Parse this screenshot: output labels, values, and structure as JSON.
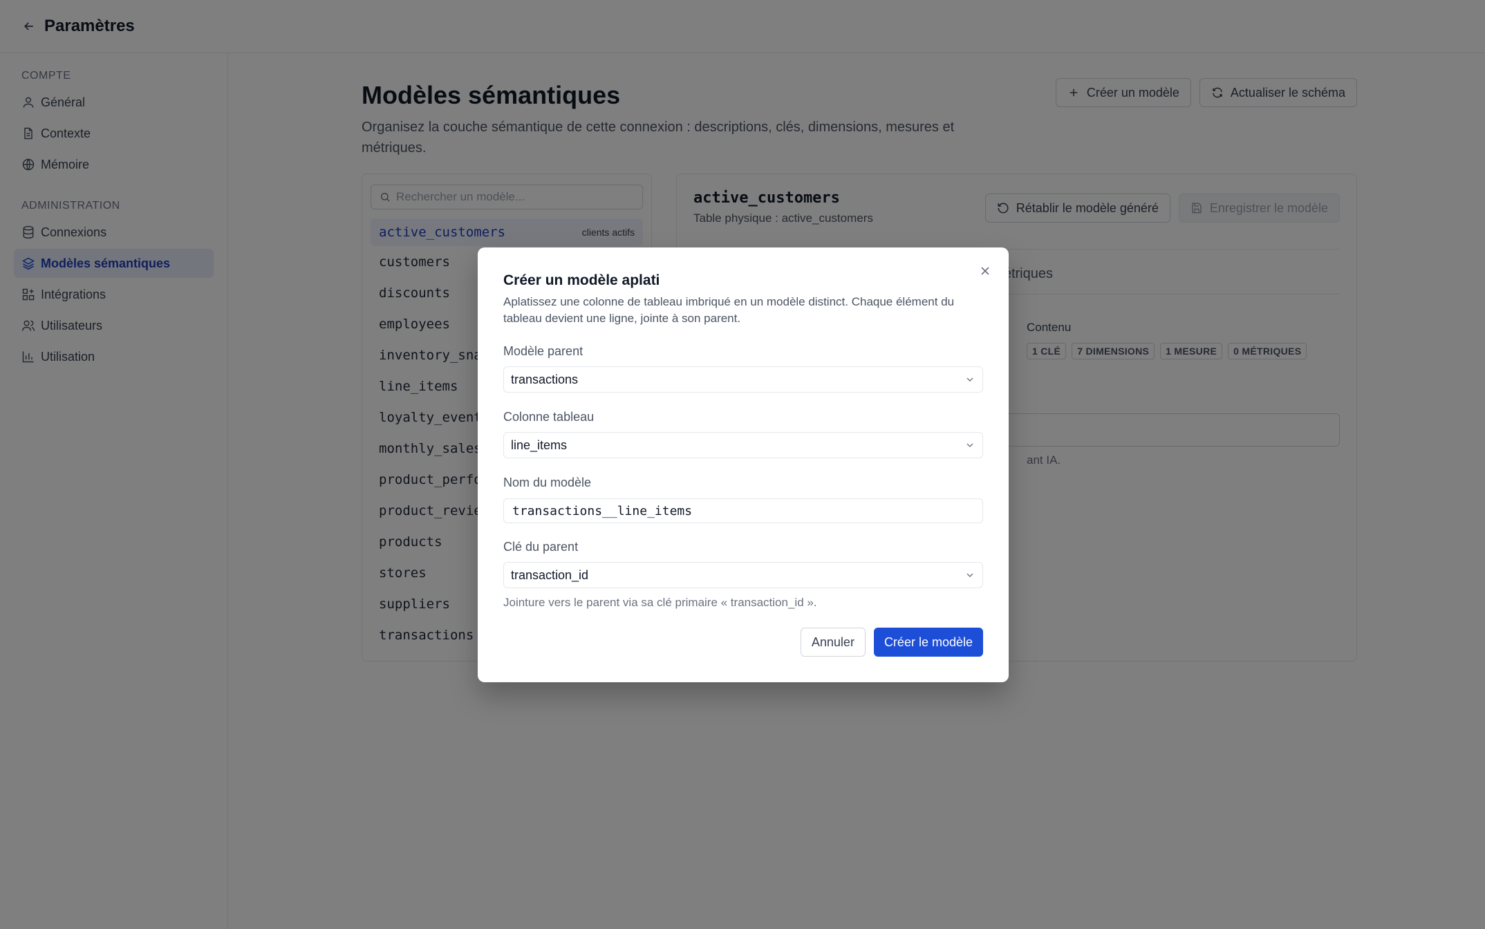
{
  "header": {
    "title": "Paramètres",
    "back_icon": "arrow-left-icon"
  },
  "sidebar": {
    "section_account": "COMPTE",
    "section_admin": "ADMINISTRATION",
    "items": [
      {
        "label": "Général",
        "icon": "user-icon"
      },
      {
        "label": "Contexte",
        "icon": "file-text-icon"
      },
      {
        "label": "Mémoire",
        "icon": "globe-icon"
      },
      {
        "label": "Connexions",
        "icon": "database-icon"
      },
      {
        "label": "Modèles sémantiques",
        "icon": "layers-icon",
        "active": true
      },
      {
        "label": "Intégrations",
        "icon": "grid-plus-icon"
      },
      {
        "label": "Utilisateurs",
        "icon": "users-icon"
      },
      {
        "label": "Utilisation",
        "icon": "bar-chart-icon"
      }
    ]
  },
  "main": {
    "title": "Modèles sémantiques",
    "description": "Organisez la couche sémantique de cette connexion : descriptions, clés, dimensions, mesures et métriques.",
    "create_button": "Créer un modèle",
    "refresh_button": "Actualiser le schéma",
    "search_placeholder": "Rechercher un modèle...",
    "active_tag": "clients actifs",
    "models": [
      "active_customers",
      "customers",
      "discounts",
      "employees",
      "inventory_snap",
      "line_items",
      "loyalty_events",
      "monthly_sales_",
      "product_perfor",
      "product_review",
      "products",
      "stores",
      "suppliers",
      "transactions"
    ],
    "detail": {
      "name": "active_customers",
      "physical_table": "Table physique : active_customers",
      "reset_button": "Rétablir le modèle généré",
      "save_button": "Enregistrer le modèle",
      "tab_partial": "étriques",
      "content_label": "Contenu",
      "chips": [
        "1 CLÉ",
        "7 DIMENSIONS",
        "1 MESURE",
        "0 MÉTRIQUES"
      ],
      "hint_partial": "ant IA."
    }
  },
  "modal": {
    "title": "Créer un modèle aplati",
    "description": "Aplatissez une colonne de tableau imbriqué en un modèle distinct. Chaque élément du tableau devient une ligne, jointe à son parent.",
    "parent_label": "Modèle parent",
    "parent_value": "transactions",
    "column_label": "Colonne tableau",
    "column_value": "line_items",
    "name_label": "Nom du modèle",
    "name_value": "transactions__line_items",
    "key_label": "Clé du parent",
    "key_value": "transaction_id",
    "hint": "Jointure vers le parent via sa clé primaire « transaction_id ».",
    "cancel_button": "Annuler",
    "submit_button": "Créer le modèle"
  }
}
